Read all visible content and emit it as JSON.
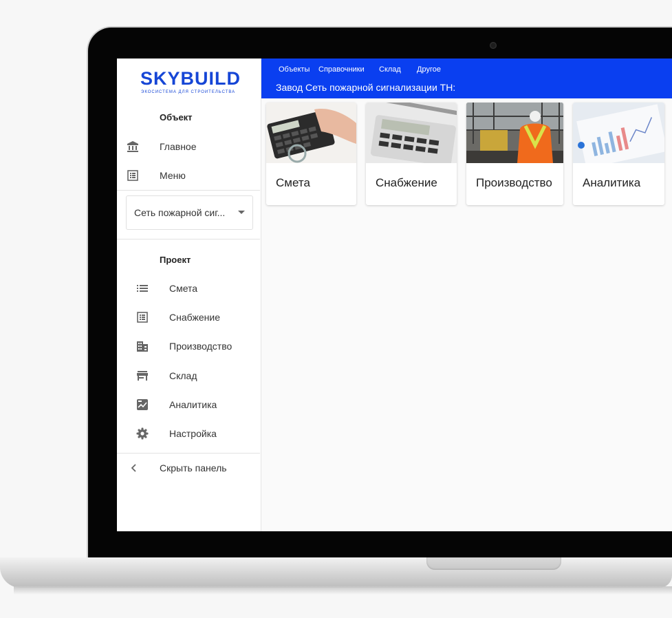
{
  "logo": {
    "name": "SKYBUILD",
    "tagline": "ЭКОСИСТЕМА ДЛЯ СТРОИТЕЛЬСТВА"
  },
  "sidebar": {
    "object_title": "Объект",
    "object_items": [
      {
        "label": "Главное",
        "icon": "bank-icon"
      },
      {
        "label": "Меню",
        "icon": "list-alt-icon"
      }
    ],
    "object_select": {
      "value": "Сеть пожарной сиг..."
    },
    "project_title": "Проект",
    "project_items": [
      {
        "label": "Смета",
        "icon": "list-icon"
      },
      {
        "label": "Снабжение",
        "icon": "list-alt-icon"
      },
      {
        "label": "Производство",
        "icon": "building-icon"
      },
      {
        "label": "Склад",
        "icon": "store-icon"
      },
      {
        "label": "Аналитика",
        "icon": "chart-icon"
      },
      {
        "label": "Настройка",
        "icon": "gear-icon"
      }
    ],
    "hide_label": "Скрыть панель"
  },
  "topbar": {
    "menu": [
      "Объекты",
      "Справочники",
      "Склад",
      "Другое"
    ],
    "subtitle": "Завод Сеть пожарной сигнализации ТН:"
  },
  "cards": [
    {
      "title": "Смета",
      "image": "calculator-hand-photo"
    },
    {
      "title": "Снабжение",
      "image": "calculator-pen-photo"
    },
    {
      "title": "Производство",
      "image": "construction-worker-photo"
    },
    {
      "title": "Аналитика",
      "image": "charts-document-photo"
    }
  ],
  "colors": {
    "accent": "#0a3ff0",
    "logo": "#1646d6"
  }
}
